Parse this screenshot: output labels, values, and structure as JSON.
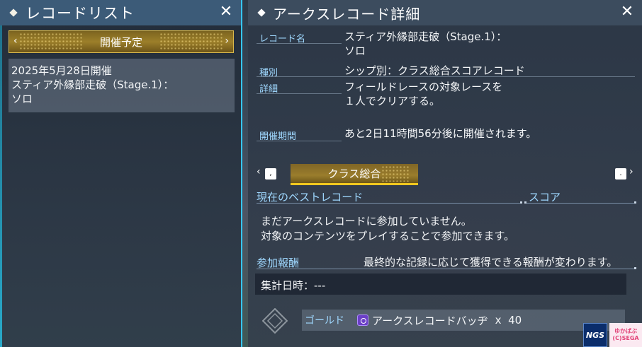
{
  "left_panel": {
    "title": "レコードリスト",
    "tab_label": "開催予定",
    "tab_prev": "‹",
    "tab_next": "›",
    "record": {
      "date": "2025年5月28日開催",
      "name_line1": "スティア外縁部走破（Stage.1）：",
      "name_line2": "ソロ"
    }
  },
  "right_panel": {
    "title": "アークスレコード詳細",
    "fields": {
      "record_name_label": "レコード名",
      "record_name_line1": "スティア外縁部走破（Stage.1）：",
      "record_name_line2": "ソロ",
      "type_label": "種別",
      "type_value": "シップ別：クラス総合スコアレコード",
      "detail_label": "詳細",
      "detail_line1": "フィールドレースの対象レースを",
      "detail_line2": "１人でクリアする。",
      "period_label": "開催期間",
      "period_value": "あと2日11時間56分後に開催されます。"
    },
    "category": {
      "label": "クラス総合",
      "prev_key": ",",
      "next_key": "."
    },
    "best_record": {
      "header": "現在のベストレコード",
      "score_header": "スコア",
      "message_line1": "まだアークスレコードに参加していません。",
      "message_line2": "対象のコンテンツをプレイすることで参加できます。"
    },
    "rewards": {
      "header": "参加報酬",
      "note": "最終的な記録に応じて獲得できる報酬が変わります。",
      "tally_time": "集計日時：---",
      "items": [
        {
          "tier": "ゴールド",
          "icon": "arks-record-badge-icon",
          "name": "アークスレコードバッヂ",
          "quantity": "x  40"
        }
      ]
    }
  },
  "logos": {
    "ngs": "NGS",
    "pink_line1": "ゆかばぶ",
    "pink_line2": "(C)SEGA"
  },
  "colors": {
    "accent_cyan": "#36c6ff",
    "label_blue": "#9fd8ff",
    "gold": "#f1c81f"
  }
}
